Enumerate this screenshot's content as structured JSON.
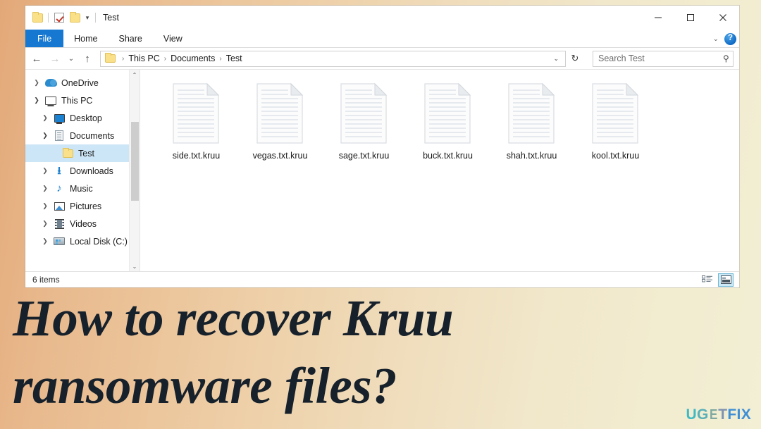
{
  "window": {
    "title": "Test",
    "quick_access": [
      "folder-icon",
      "properties-icon",
      "new-folder-icon",
      "customize-chevron-icon"
    ],
    "controls": {
      "minimize": "–",
      "maximize": "□",
      "close": "✕"
    }
  },
  "ribbon": {
    "tabs": [
      {
        "label": "File",
        "active": true
      },
      {
        "label": "Home",
        "active": false
      },
      {
        "label": "Share",
        "active": false
      },
      {
        "label": "View",
        "active": false
      }
    ],
    "collapse_chevron": "⌄",
    "help_label": "?"
  },
  "nav_toolbar": {
    "back": "←",
    "forward": "→",
    "recent": "⌄",
    "up": "↑",
    "refresh": "↻",
    "dropdown": "⌄"
  },
  "address": {
    "folder_icon": "folder-icon",
    "crumbs": [
      "This PC",
      "Documents",
      "Test"
    ],
    "separator": "›"
  },
  "search": {
    "placeholder": "Search Test",
    "value": "",
    "icon": "search-icon"
  },
  "sidebar": {
    "items": [
      {
        "label": "OneDrive",
        "icon": "cloud-icon",
        "indent": 0,
        "twisty": "collapsed",
        "selected": false
      },
      {
        "label": "This PC",
        "icon": "pc-icon",
        "indent": 0,
        "twisty": "expanded",
        "selected": false
      },
      {
        "label": "Desktop",
        "icon": "desktop-icon",
        "indent": 1,
        "twisty": "collapsed",
        "selected": false
      },
      {
        "label": "Documents",
        "icon": "documents-icon",
        "indent": 1,
        "twisty": "expanded",
        "selected": false
      },
      {
        "label": "Test",
        "icon": "folder-icon",
        "indent": 2,
        "twisty": "none",
        "selected": true
      },
      {
        "label": "Downloads",
        "icon": "download-icon",
        "indent": 1,
        "twisty": "collapsed",
        "selected": false
      },
      {
        "label": "Music",
        "icon": "music-icon",
        "indent": 1,
        "twisty": "collapsed",
        "selected": false
      },
      {
        "label": "Pictures",
        "icon": "pictures-icon",
        "indent": 1,
        "twisty": "collapsed",
        "selected": false
      },
      {
        "label": "Videos",
        "icon": "video-icon",
        "indent": 1,
        "twisty": "collapsed",
        "selected": false
      },
      {
        "label": "Local Disk (C:)",
        "icon": "disk-icon",
        "indent": 1,
        "twisty": "collapsed",
        "selected": false
      }
    ],
    "scroll_up": "⌃",
    "scroll_down": "⌄"
  },
  "files": [
    {
      "name": "side.txt.kruu",
      "icon": "text-document-icon"
    },
    {
      "name": "vegas.txt.kruu",
      "icon": "text-document-icon"
    },
    {
      "name": "sage.txt.kruu",
      "icon": "text-document-icon"
    },
    {
      "name": "buck.txt.kruu",
      "icon": "text-document-icon"
    },
    {
      "name": "shah.txt.kruu",
      "icon": "text-document-icon"
    },
    {
      "name": "kool.txt.kruu",
      "icon": "text-document-icon"
    }
  ],
  "status": {
    "item_count": "6 items",
    "views": [
      {
        "name": "details-view",
        "active": false
      },
      {
        "name": "large-icons-view",
        "active": true
      }
    ]
  },
  "caption": {
    "line1": "How to recover Kruu",
    "line2": "ransomware files?"
  },
  "logo": {
    "full": "UGETFIX",
    "parts": [
      "U",
      "G",
      "E",
      "T",
      "F",
      "I",
      "X"
    ]
  },
  "colors": {
    "accent_blue": "#1678d0",
    "selection": "#cde6f7",
    "bg_left": "#e3a878",
    "bg_right": "#f2efd4",
    "caption_text": "#17212b",
    "logo_teal": "#3fb9c4",
    "logo_blue": "#3f8fd6"
  }
}
